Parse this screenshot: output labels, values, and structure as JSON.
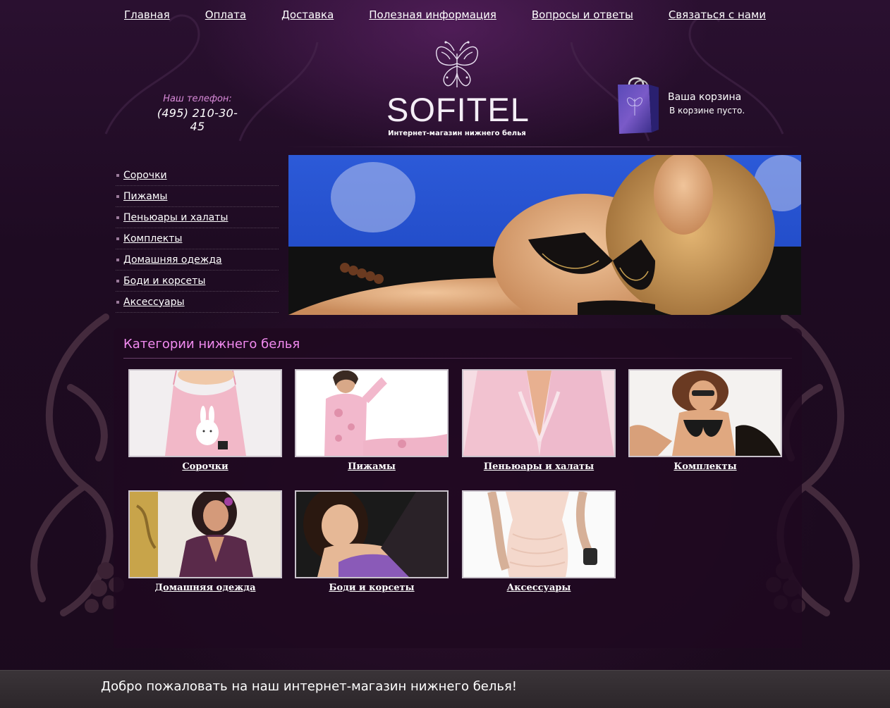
{
  "nav": {
    "items": [
      {
        "label": "Главная"
      },
      {
        "label": "Оплата"
      },
      {
        "label": "Доставка"
      },
      {
        "label": "Полезная информация"
      },
      {
        "label": "Вопросы и ответы"
      },
      {
        "label": "Связаться с нами"
      }
    ]
  },
  "header": {
    "phone_label": "Наш телефон:",
    "phone_number": "(495) 210-30-45",
    "logo_text": "SOFITEL",
    "logo_tagline": "Интернет-магазин нижнего белья",
    "cart_title": "Ваша корзина",
    "cart_status": "В корзине пусто."
  },
  "sidebar": {
    "items": [
      {
        "label": "Сорочки"
      },
      {
        "label": "Пижамы"
      },
      {
        "label": "Пеньюары и халаты"
      },
      {
        "label": "Комплекты"
      },
      {
        "label": "Домашняя одежда"
      },
      {
        "label": "Боди и корсеты"
      },
      {
        "label": "Аксессуары"
      }
    ]
  },
  "categories": {
    "title": "Категории нижнего белья",
    "items": [
      {
        "label": "Сорочки"
      },
      {
        "label": "Пижамы"
      },
      {
        "label": "Пеньюары и халаты"
      },
      {
        "label": "Комплекты"
      },
      {
        "label": "Домашняя одежда"
      },
      {
        "label": "Боди и корсеты"
      },
      {
        "label": "Аксессуары"
      }
    ]
  },
  "footer": {
    "welcome": "Добро пожаловать на наш интернет-магазин нижнего белья!"
  },
  "colors": {
    "accent": "#f28bf0",
    "phone_label": "#d88ad8",
    "background": "#1a0a1c",
    "footer_bg": "#2c262a"
  }
}
